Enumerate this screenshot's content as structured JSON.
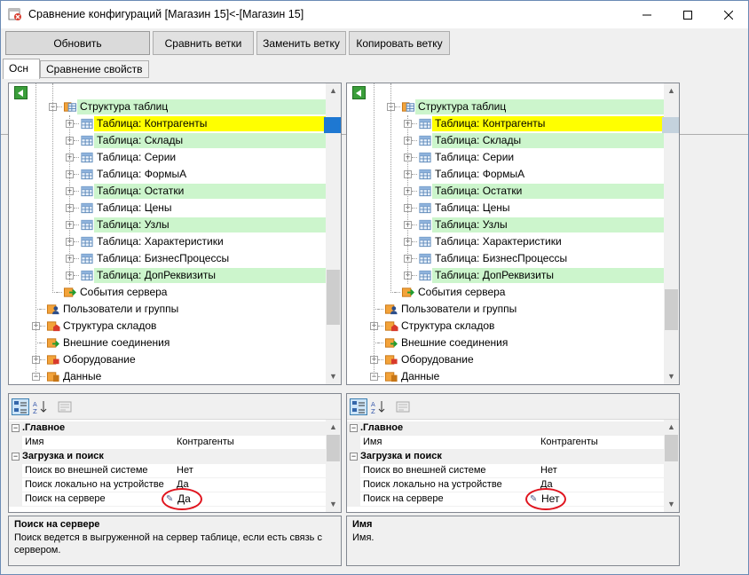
{
  "window": {
    "title": "Сравнение конфигураций [Магазин 15]<-[Магазин 15]"
  },
  "toolbar": {
    "refresh": "Обновить",
    "compare": "Сравнить ветки",
    "replace": "Заменить ветку",
    "copy": "Копировать ветку"
  },
  "tabs": [
    "Осн",
    "Сравнение свойств"
  ],
  "colors": {
    "accent_green": "#ccf5cc",
    "selected_yellow": "#ffff00",
    "highlight_circle": "#e0141e"
  },
  "left_tree": [
    {
      "label": "Структура таблиц",
      "level": 2,
      "icon": "table-structure-icon",
      "expand": "-",
      "bg": "#ccf5cc"
    },
    {
      "label": "Таблица: Контрагенты",
      "level": 3,
      "icon": "table-icon",
      "expand": "+",
      "bg": "#ffff00"
    },
    {
      "label": "Таблица: Склады",
      "level": 3,
      "icon": "table-icon",
      "expand": "+",
      "bg": "#ccf5cc"
    },
    {
      "label": "Таблица: Серии",
      "level": 3,
      "icon": "table-icon",
      "expand": "+",
      "bg": ""
    },
    {
      "label": "Таблица: ФормыА",
      "level": 3,
      "icon": "table-icon",
      "expand": "+",
      "bg": ""
    },
    {
      "label": "Таблица: Остатки",
      "level": 3,
      "icon": "table-icon",
      "expand": "+",
      "bg": "#ccf5cc"
    },
    {
      "label": "Таблица: Цены",
      "level": 3,
      "icon": "table-icon",
      "expand": "+",
      "bg": ""
    },
    {
      "label": "Таблица: Узлы",
      "level": 3,
      "icon": "table-icon",
      "expand": "+",
      "bg": "#ccf5cc"
    },
    {
      "label": "Таблица: Характеристики",
      "level": 3,
      "icon": "table-icon",
      "expand": "+",
      "bg": ""
    },
    {
      "label": "Таблица: БизнесПроцессы",
      "level": 3,
      "icon": "table-icon",
      "expand": "+",
      "bg": ""
    },
    {
      "label": "Таблица: ДопРеквизиты",
      "level": 3,
      "icon": "table-icon",
      "expand": "+",
      "bg": "#ccf5cc"
    },
    {
      "label": "События сервера",
      "level": 2,
      "icon": "server-events-icon",
      "expand": "",
      "bg": ""
    },
    {
      "label": "Пользователи и группы",
      "level": 1,
      "icon": "users-icon",
      "expand": "",
      "bg": ""
    },
    {
      "label": "Структура складов",
      "level": 1,
      "icon": "warehouse-icon",
      "expand": "+",
      "bg": ""
    },
    {
      "label": "Внешние соединения",
      "level": 1,
      "icon": "connections-icon",
      "expand": "",
      "bg": ""
    },
    {
      "label": "Оборудование",
      "level": 1,
      "icon": "equipment-icon",
      "expand": "+",
      "bg": ""
    },
    {
      "label": "Данные",
      "level": 1,
      "icon": "data-icon",
      "expand": "-",
      "bg": ""
    }
  ],
  "right_tree": [
    {
      "label": "Структура таблиц",
      "level": 2,
      "icon": "table-structure-icon",
      "expand": "-",
      "bg": "#ccf5cc"
    },
    {
      "label": "Таблица: Контрагенты",
      "level": 3,
      "icon": "table-icon",
      "expand": "+",
      "bg": "#ffff00"
    },
    {
      "label": "Таблица: Склады",
      "level": 3,
      "icon": "table-icon",
      "expand": "+",
      "bg": "#ccf5cc"
    },
    {
      "label": "Таблица: Серии",
      "level": 3,
      "icon": "table-icon",
      "expand": "+",
      "bg": ""
    },
    {
      "label": "Таблица: ФормыА",
      "level": 3,
      "icon": "table-icon",
      "expand": "+",
      "bg": ""
    },
    {
      "label": "Таблица: Остатки",
      "level": 3,
      "icon": "table-icon",
      "expand": "+",
      "bg": "#ccf5cc"
    },
    {
      "label": "Таблица: Цены",
      "level": 3,
      "icon": "table-icon",
      "expand": "+",
      "bg": ""
    },
    {
      "label": "Таблица: Узлы",
      "level": 3,
      "icon": "table-icon",
      "expand": "+",
      "bg": "#ccf5cc"
    },
    {
      "label": "Таблица: Характеристики",
      "level": 3,
      "icon": "table-icon",
      "expand": "+",
      "bg": ""
    },
    {
      "label": "Таблица: БизнесПроцессы",
      "level": 3,
      "icon": "table-icon",
      "expand": "+",
      "bg": ""
    },
    {
      "label": "Таблица: ДопРеквизиты",
      "level": 3,
      "icon": "table-icon",
      "expand": "+",
      "bg": "#ccf5cc"
    },
    {
      "label": "События сервера",
      "level": 2,
      "icon": "server-events-icon",
      "expand": "",
      "bg": ""
    },
    {
      "label": "Пользователи и группы",
      "level": 1,
      "icon": "users-icon",
      "expand": "",
      "bg": ""
    },
    {
      "label": "Структура складов",
      "level": 1,
      "icon": "warehouse-icon",
      "expand": "+",
      "bg": ""
    },
    {
      "label": "Внешние соединения",
      "level": 1,
      "icon": "connections-icon",
      "expand": "",
      "bg": ""
    },
    {
      "label": "Оборудование",
      "level": 1,
      "icon": "equipment-icon",
      "expand": "+",
      "bg": ""
    },
    {
      "label": "Данные",
      "level": 1,
      "icon": "data-icon",
      "expand": "-",
      "bg": ""
    }
  ],
  "left_grid": [
    {
      "type": "category",
      "name": ".Главное"
    },
    {
      "type": "prop",
      "name": "Имя",
      "value": "Контрагенты"
    },
    {
      "type": "category",
      "name": "Загрузка и поиск"
    },
    {
      "type": "prop",
      "name": "Поиск во внешней системе",
      "value": "Нет"
    },
    {
      "type": "prop",
      "name": "Поиск локально на устройстве",
      "value": "Да"
    },
    {
      "type": "prop",
      "name": "Поиск на сервере",
      "value": "Да",
      "changed": true
    }
  ],
  "right_grid": [
    {
      "type": "category",
      "name": ".Главное"
    },
    {
      "type": "prop",
      "name": "Имя",
      "value": "Контрагенты"
    },
    {
      "type": "category",
      "name": "Загрузка и поиск"
    },
    {
      "type": "prop",
      "name": "Поиск во внешней системе",
      "value": "Нет"
    },
    {
      "type": "prop",
      "name": "Поиск локально на устройстве",
      "value": "Да"
    },
    {
      "type": "prop",
      "name": "Поиск на сервере",
      "value": "Нет",
      "changed": true
    }
  ],
  "left_desc": {
    "title": "Поиск на сервере",
    "text": "Поиск ведется в выгруженной на сервер таблице, если есть связь с сервером."
  },
  "right_desc": {
    "title": "Имя",
    "text": "Имя."
  }
}
